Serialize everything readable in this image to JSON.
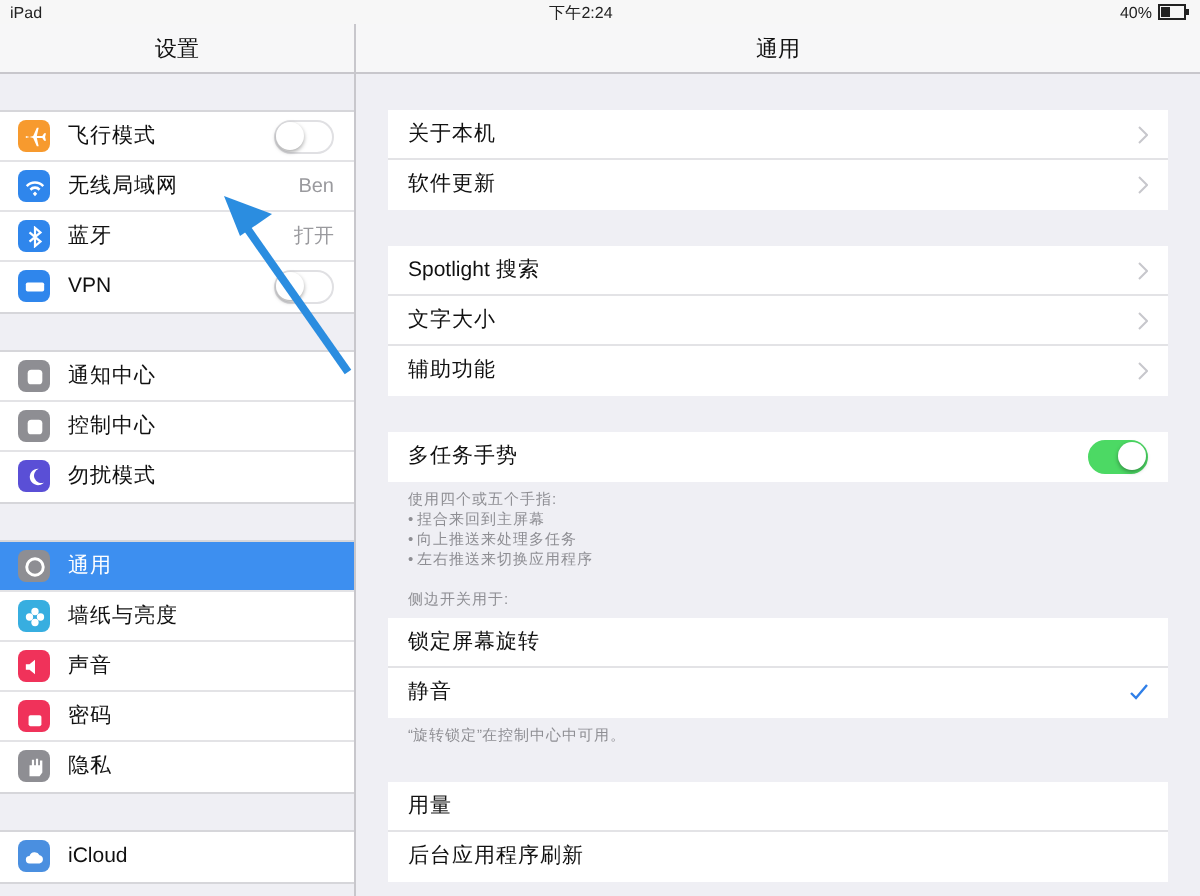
{
  "status_bar": {
    "carrier": "iPad",
    "time": "下午2:24",
    "battery": "40%"
  },
  "sidebar": {
    "title": "设置",
    "groups": [
      [
        {
          "label": "飞行模式",
          "color": "#f79a2e",
          "selected": false,
          "kind": "switch",
          "on": false
        },
        {
          "label": "无线局域网",
          "color": "#2f86ec",
          "selected": false,
          "kind": "detail",
          "value": "Ben"
        },
        {
          "label": "蓝牙",
          "color": "#2f86ec",
          "selected": false,
          "kind": "detail",
          "value": "打开"
        },
        {
          "label": "VPN",
          "color": "#2f86ec",
          "selected": false,
          "kind": "switch",
          "on": false
        }
      ],
      [
        {
          "label": "通知中心",
          "color": "#8e8e93",
          "selected": false,
          "kind": "plain"
        },
        {
          "label": "控制中心",
          "color": "#8e8e93",
          "selected": false,
          "kind": "plain"
        },
        {
          "label": "勿扰模式",
          "color": "#5a4fd6",
          "selected": false,
          "kind": "plain"
        }
      ],
      [
        {
          "label": "通用",
          "color": "#8e8e93",
          "selected": true,
          "kind": "plain"
        },
        {
          "label": "墙纸与亮度",
          "color": "#37aee0",
          "selected": false,
          "kind": "plain"
        },
        {
          "label": "声音",
          "color": "#f0325a",
          "selected": false,
          "kind": "plain"
        },
        {
          "label": "密码",
          "color": "#f0325a",
          "selected": false,
          "kind": "plain"
        },
        {
          "label": "隐私",
          "color": "#8e8e93",
          "selected": false,
          "kind": "plain"
        }
      ],
      [
        {
          "label": "iCloud",
          "color": "#4a8fe0",
          "selected": false,
          "kind": "plain"
        }
      ]
    ]
  },
  "detail": {
    "title": "通用",
    "groups": [
      {
        "rows": [
          {
            "label": "关于本机",
            "kind": "chevron"
          },
          {
            "label": "软件更新",
            "kind": "chevron"
          }
        ]
      },
      {
        "rows": [
          {
            "label": "Spotlight 搜索",
            "kind": "chevron"
          },
          {
            "label": "文字大小",
            "kind": "chevron"
          },
          {
            "label": "辅助功能",
            "kind": "chevron"
          }
        ]
      },
      {
        "rows": [
          {
            "label": "多任务手势",
            "kind": "switch",
            "on": true
          }
        ],
        "footer": [
          "使用四个或五个手指:",
          "• 捏合来回到主屏幕",
          "• 向上推送来处理多任务",
          "• 左右推送来切换应用程序"
        ]
      },
      {
        "header": "侧边开关用于:",
        "rows": [
          {
            "label": "锁定屏幕旋转",
            "kind": "choice",
            "selected": false
          },
          {
            "label": "静音",
            "kind": "choice",
            "selected": true
          }
        ],
        "footer": [
          "“旋转锁定”在控制中心中可用。"
        ]
      },
      {
        "rows": [
          {
            "label": "用量",
            "kind": "plain"
          },
          {
            "label": "后台应用程序刷新",
            "kind": "plain"
          }
        ]
      }
    ]
  }
}
